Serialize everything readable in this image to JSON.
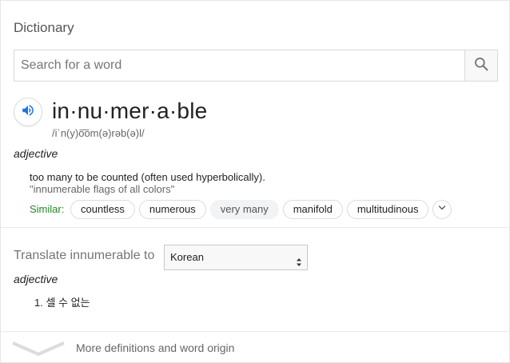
{
  "panel": {
    "title": "Dictionary"
  },
  "search": {
    "placeholder": "Search for a word",
    "value": "",
    "icon": "search-icon"
  },
  "entry": {
    "audio_icon": "speaker-icon",
    "headword": "in·nu·mer·a·ble",
    "phonetic": "/iˈn(y)o͞om(ə)rəb(ə)l/",
    "part_of_speech": "adjective",
    "definition": "too many to be counted (often used hyperbolically).",
    "example": "\"innumerable flags of all colors\"",
    "similar_label": "Similar:",
    "similar": [
      "countless",
      "numerous",
      "very many",
      "manifold",
      "multitudinous"
    ],
    "expand_icon": "chevron-down-icon"
  },
  "translate": {
    "label": "Translate innumerable to",
    "language": "Korean",
    "part_of_speech": "adjective",
    "result": "1. 셀 수 없는"
  },
  "footer": {
    "more_label": "More definitions and word origin",
    "icon": "chevron-down-icon"
  },
  "colors": {
    "accent_blue": "#1a73e8",
    "similar_green": "#228822",
    "muted_text": "#666666"
  }
}
